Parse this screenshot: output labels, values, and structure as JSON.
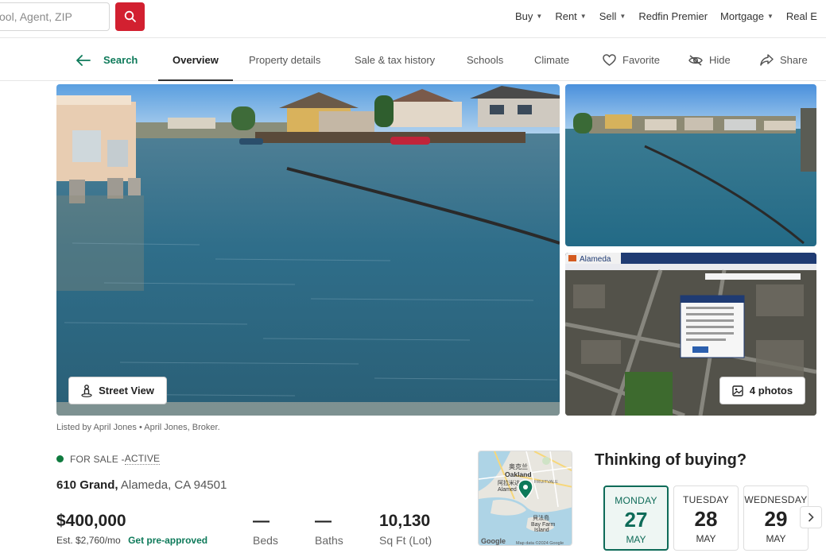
{
  "search": {
    "placeholder": "ool, Agent, ZIP"
  },
  "topnav": {
    "items": [
      {
        "label": "Buy",
        "caret": true
      },
      {
        "label": "Rent",
        "caret": true
      },
      {
        "label": "Sell",
        "caret": true
      },
      {
        "label": "Redfin Premier",
        "caret": false
      },
      {
        "label": "Mortgage",
        "caret": true
      },
      {
        "label": "Real E",
        "caret": false
      }
    ]
  },
  "subnav": {
    "back_label": "Search",
    "tabs": [
      "Overview",
      "Property details",
      "Sale & tax history",
      "Schools",
      "Climate"
    ],
    "active_tab": "Overview",
    "favorite_label": "Favorite",
    "hide_label": "Hide",
    "share_label": "Share"
  },
  "photos": {
    "street_view_label": "Street View",
    "count_label": "4 photos",
    "parcel_brand": "Alameda"
  },
  "listing": {
    "listed_by": "Listed by April Jones • April Jones, Broker.",
    "status_prefix": "FOR SALE - ",
    "status_active": "ACTIVE",
    "status_color": "#0f7a3e",
    "street": "610 Grand,",
    "city": " Alameda, CA 94501",
    "price": "$400,000",
    "est_payment": "Est. $2,760/mo",
    "preapproved_label": "Get pre-approved",
    "beds_value": "—",
    "beds_label": "Beds",
    "baths_value": "—",
    "baths_label": "Baths",
    "sqft_value": "10,130",
    "sqft_label": "Sq Ft (Lot)"
  },
  "map": {
    "city_cn": "奥克兰",
    "city": "Oakland",
    "area_cn": "阿拉米达",
    "area": "Alamed",
    "fruitvale": "FRUITVALE",
    "bayfarm_cn": "貝法島",
    "bayfarm": "Bay Farm",
    "island": "Island",
    "attribution": "Map data ©2024 Google",
    "google": "Google"
  },
  "tour": {
    "heading": "Thinking of buying?",
    "days": [
      {
        "dow": "MONDAY",
        "num": "27",
        "mon": "MAY",
        "selected": true
      },
      {
        "dow": "TUESDAY",
        "num": "28",
        "mon": "MAY",
        "selected": false
      },
      {
        "dow": "WEDNESDAY",
        "num": "29",
        "mon": "MAY",
        "selected": false
      }
    ]
  },
  "colors": {
    "brand_red": "#d22030",
    "accent_green": "#0e7a5a"
  }
}
